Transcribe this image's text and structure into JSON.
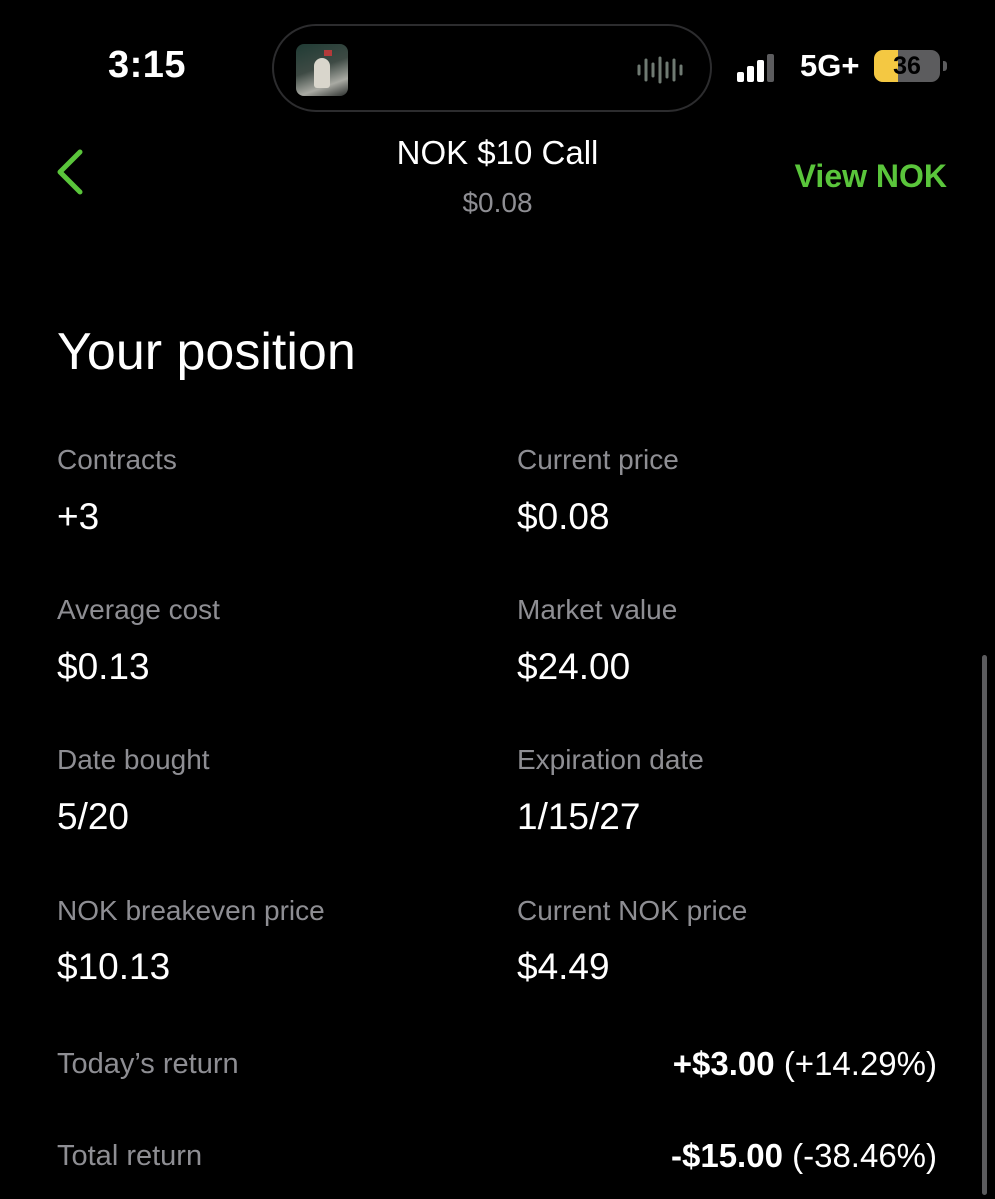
{
  "status_bar": {
    "time": "3:15",
    "network": "5G+",
    "battery_level": "36",
    "battery_percent": 36,
    "signal_bars_filled": 3,
    "signal_bars_total": 4,
    "music_art_icon": "album-art",
    "waveform_icon": "audio-waveform-icon"
  },
  "header": {
    "title": "NOK $10 Call",
    "subtitle": "$0.08",
    "back_icon": "chevron-left-icon",
    "view_link": "View NOK",
    "accent_color": "#5ac53b"
  },
  "position": {
    "title": "Your position",
    "stats": [
      {
        "label": "Contracts",
        "value": "+3"
      },
      {
        "label": "Current price",
        "value": "$0.08"
      },
      {
        "label": "Average cost",
        "value": "$0.13"
      },
      {
        "label": "Market value",
        "value": "$24.00"
      },
      {
        "label": "Date bought",
        "value": "5/20"
      },
      {
        "label": "Expiration date",
        "value": "1/15/27"
      },
      {
        "label": "NOK breakeven price",
        "value": "$10.13"
      },
      {
        "label": "Current NOK price",
        "value": "$4.49"
      }
    ],
    "returns": [
      {
        "label": "Today’s return",
        "amount": "+$3.00",
        "percent": "(+14.29%)"
      },
      {
        "label": "Total return",
        "amount": "-$15.00",
        "percent": "(-38.46%)"
      }
    ]
  }
}
